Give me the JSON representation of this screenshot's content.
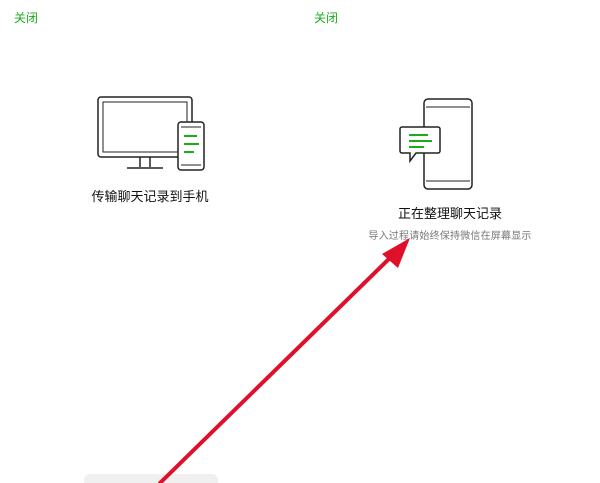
{
  "left_panel": {
    "close_label": "关闭",
    "caption": "传输聊天记录到手机"
  },
  "right_panel": {
    "close_label": "关闭",
    "title": "正在整理聊天记录",
    "subtitle": "导入过程请始终保持微信在屏幕显示"
  },
  "colors": {
    "accent": "#1aad19",
    "annotation_arrow": "#e0102b",
    "illustration_stroke": "#222222"
  },
  "icons": {
    "left_illustration": "computer-and-phone-icon",
    "right_illustration": "phone-with-chat-icon"
  }
}
